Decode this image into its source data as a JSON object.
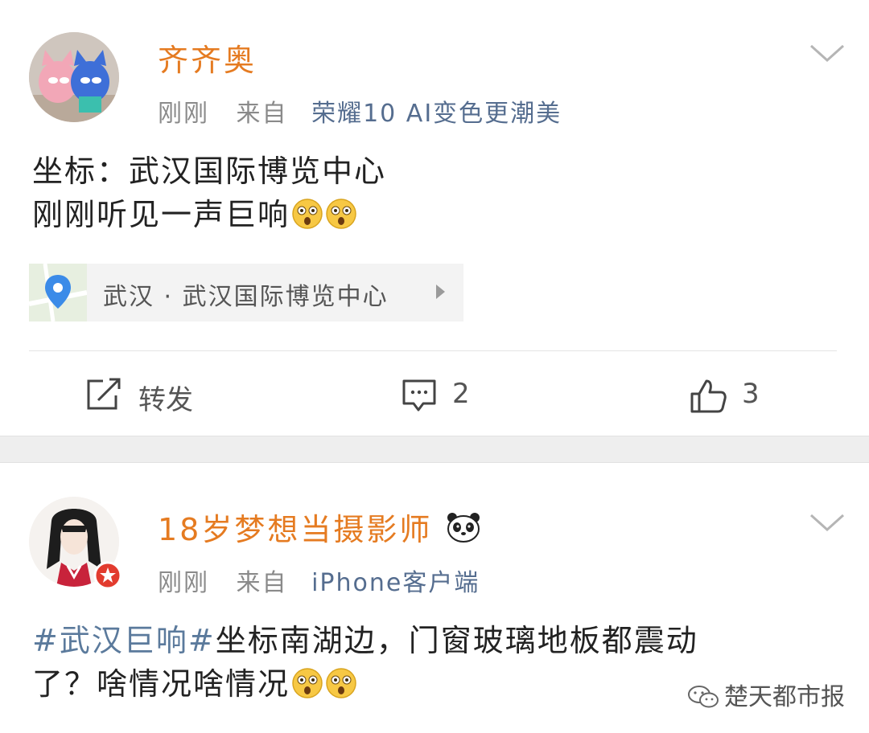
{
  "post1": {
    "username": "齐齐奥",
    "time": "刚刚",
    "from_label": "来自",
    "source": "荣耀10 AI变色更潮美",
    "content_line1": "坐标：武汉国际博览中心",
    "content_line2": "刚刚听见一声巨响",
    "location": "武汉 · 武汉国际博览中心",
    "actions": {
      "repost_label": "转发",
      "comment_count": "2",
      "like_count": "3"
    }
  },
  "post2": {
    "username": "18岁梦想当摄影师",
    "time": "刚刚",
    "from_label": "来自",
    "source": "iPhone客户端",
    "topic": "#武汉巨响#",
    "content_line1_rest": "坐标南湖边，门窗玻璃地板都震动",
    "content_line2": "了？啥情况啥情况"
  },
  "watermark": "楚天都市报",
  "colors": {
    "username": "#e57b21",
    "topic": "#5b7a9c",
    "meta": "#8a8a8a",
    "separator": "#eeeeee"
  },
  "icons": [
    "chevron-down-icon",
    "location-pin-icon",
    "repost-icon",
    "comment-icon",
    "like-icon",
    "panda-icon",
    "surprised-emoji-icon",
    "wechat-icon"
  ]
}
